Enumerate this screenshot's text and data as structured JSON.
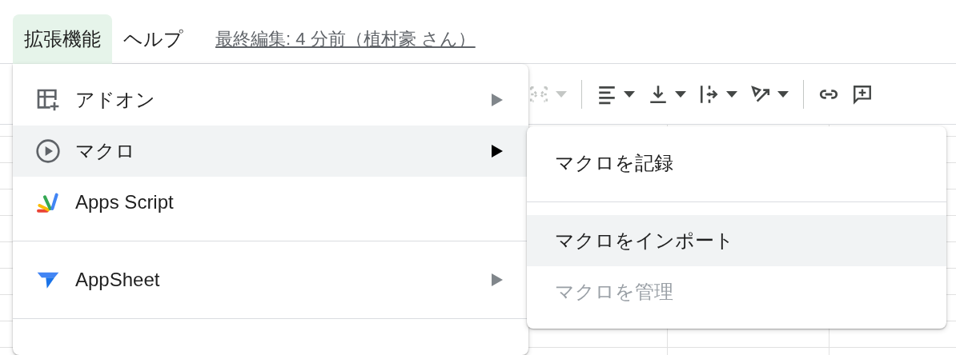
{
  "menubar": {
    "items": [
      {
        "label": "拡張機能",
        "selected": true
      },
      {
        "label": "ヘルプ",
        "selected": false
      }
    ],
    "last_edit": "最終編集: 4 分前（植村豪 さん）"
  },
  "toolbar": {
    "buttons": [
      {
        "kind": "merge",
        "disabled": true,
        "dropdown": true
      },
      {
        "kind": "divider"
      },
      {
        "kind": "align",
        "disabled": false,
        "dropdown": true
      },
      {
        "kind": "valign",
        "disabled": false,
        "dropdown": true
      },
      {
        "kind": "wrap",
        "disabled": false,
        "dropdown": true
      },
      {
        "kind": "rotate",
        "disabled": false,
        "dropdown": true
      },
      {
        "kind": "divider"
      },
      {
        "kind": "link",
        "disabled": false,
        "dropdown": false
      },
      {
        "kind": "comment",
        "disabled": false,
        "dropdown": false
      }
    ]
  },
  "menu": {
    "items": [
      {
        "kind": "addon",
        "label": "アドオン",
        "submenu": true,
        "selected": false
      },
      {
        "kind": "macro",
        "label": "マクロ",
        "submenu": true,
        "selected": true
      },
      {
        "kind": "script",
        "label": "Apps Script",
        "submenu": false,
        "selected": false
      },
      {
        "kind": "divider"
      },
      {
        "kind": "appsheet",
        "label": "AppSheet",
        "submenu": true,
        "selected": false
      },
      {
        "kind": "divider"
      }
    ]
  },
  "submenu": {
    "items": [
      {
        "kind": "item",
        "label": "マクロを記録",
        "selected": false,
        "disabled": false
      },
      {
        "kind": "divider"
      },
      {
        "kind": "item",
        "label": "マクロをインポート",
        "selected": true,
        "disabled": false
      },
      {
        "kind": "item",
        "label": "マクロを管理",
        "selected": false,
        "disabled": true
      }
    ]
  }
}
